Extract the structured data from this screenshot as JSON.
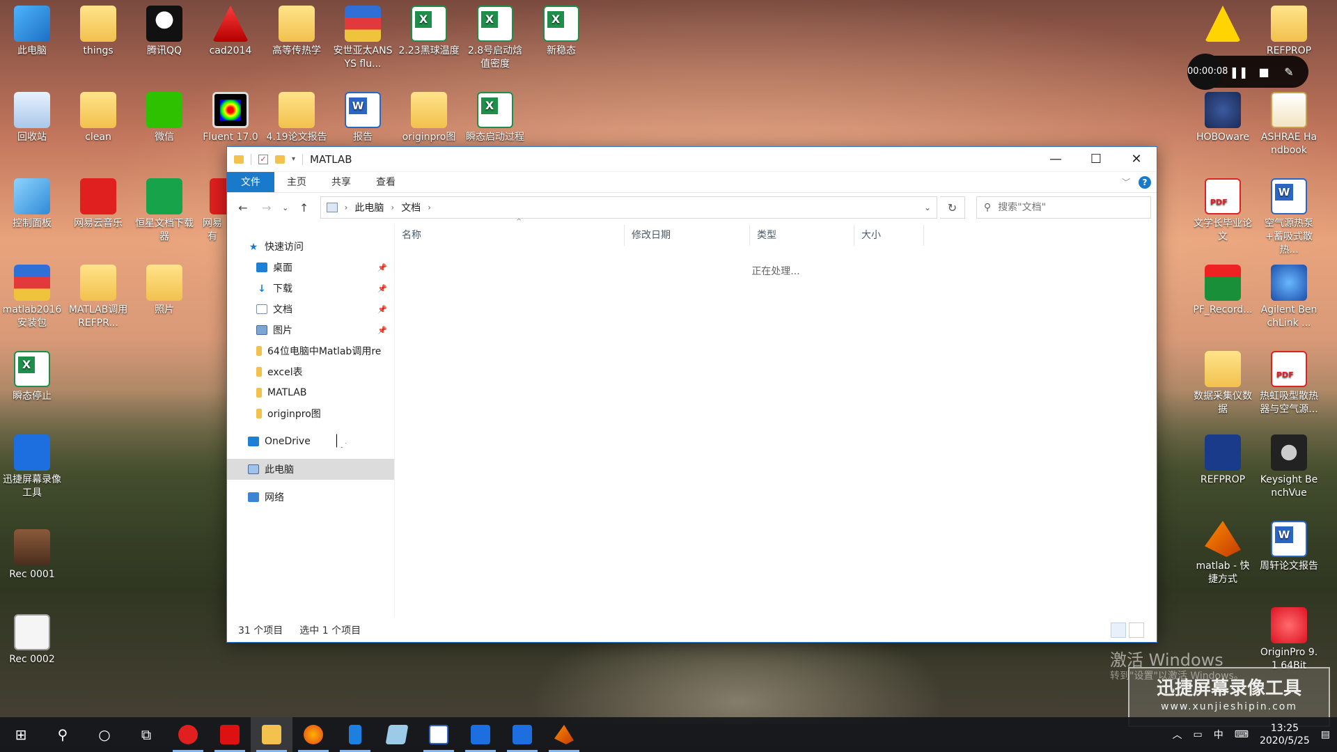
{
  "colors": {
    "accent": "#1979ca",
    "selection": "#dcdcdc",
    "taskbar": "#141619"
  },
  "desktop": {
    "icons": [
      {
        "label": "此电脑",
        "icon": "computer-icon"
      },
      {
        "label": "things",
        "icon": "folder-icon"
      },
      {
        "label": "腾讯QQ",
        "icon": "qq-icon"
      },
      {
        "label": "cad2014",
        "icon": "autocad-icon"
      },
      {
        "label": "高等传热学",
        "icon": "folder-icon"
      },
      {
        "label": "安世亚太ANSYS flu...",
        "icon": "archive-icon"
      },
      {
        "label": "2.23黑球温度",
        "icon": "excel-icon"
      },
      {
        "label": "2.8号启动焓值密度",
        "icon": "excel-icon"
      },
      {
        "label": "新稳态",
        "icon": "excel-icon"
      },
      {
        "label": "回收站",
        "icon": "recycle-bin-icon"
      },
      {
        "label": "clean",
        "icon": "folder-icon"
      },
      {
        "label": "微信",
        "icon": "wechat-icon"
      },
      {
        "label": "Fluent 17.0",
        "icon": "fluent-icon"
      },
      {
        "label": "4.19论文报告",
        "icon": "folder-icon"
      },
      {
        "label": "报告",
        "icon": "word-icon"
      },
      {
        "label": "originpro图",
        "icon": "folder-icon"
      },
      {
        "label": "瞬态启动过程",
        "icon": "excel-icon"
      },
      {
        "label": "控制面板",
        "icon": "control-panel-icon"
      },
      {
        "label": "网易云音乐",
        "icon": "netease-music-icon"
      },
      {
        "label": "恒星文档下载器",
        "icon": "downloader-icon"
      },
      {
        "label": "网易有",
        "icon": "netease-icon"
      },
      {
        "label": "matlab2016安装包",
        "icon": "archive-icon"
      },
      {
        "label": "MATLAB调用REFPR...",
        "icon": "folder-icon"
      },
      {
        "label": "照片",
        "icon": "folder-icon"
      },
      {
        "label": "瞬态停止",
        "icon": "excel-icon"
      },
      {
        "label": "迅捷屏幕录像工具",
        "icon": "screen-recorder-icon"
      },
      {
        "label": "Rec 0001",
        "icon": "video-file-icon"
      },
      {
        "label": "Rec 0002",
        "icon": "media-file-icon"
      },
      {
        "label": "REFPROP",
        "icon": "folder-icon"
      },
      {
        "label": "HOBOware",
        "icon": "hoboware-icon"
      },
      {
        "label": "ASHRAE Handbook",
        "icon": "pdf-folder-icon"
      },
      {
        "label": "文学长毕业论文",
        "icon": "pdf-icon"
      },
      {
        "label": "空气源热泵+蓄吸式散热...",
        "icon": "word-icon"
      },
      {
        "label": "PF_Record...",
        "icon": "pf-record-icon"
      },
      {
        "label": "Agilent BenchLink ...",
        "icon": "agilent-icon"
      },
      {
        "label": "数据采集仪数据",
        "icon": "folder-icon"
      },
      {
        "label": "热虹吸型散热器与空气源...",
        "icon": "pdf-icon"
      },
      {
        "label": "REFPROP",
        "icon": "refprop-icon"
      },
      {
        "label": "Keysight BenchVue",
        "icon": "keysight-icon"
      },
      {
        "label": "matlab - 快捷方式",
        "icon": "matlab-icon"
      },
      {
        "label": "周轩论文报告",
        "icon": "word-icon"
      },
      {
        "label": "OriginPro 9.1 64Bit",
        "icon": "origin-icon"
      }
    ]
  },
  "recorder": {
    "time": "00:00:08"
  },
  "explorer": {
    "title": "MATLAB",
    "tabs": [
      "文件",
      "主页",
      "共享",
      "查看"
    ],
    "breadcrumb": [
      "此电脑",
      "文档"
    ],
    "search_placeholder": "搜索\"文档\"",
    "nav": {
      "quick_access": "快速访问",
      "pinned": [
        "桌面",
        "下载",
        "文档",
        "图片"
      ],
      "folders": [
        "64位电脑中Matlab调用re",
        "excel表",
        "MATLAB",
        "originpro图"
      ],
      "onedrive": "OneDrive",
      "this_pc": "此电脑",
      "network": "网络"
    },
    "columns": [
      "名称",
      "修改日期",
      "类型",
      "大小"
    ],
    "processing": "正在处理...",
    "status": {
      "items": "31 个项目",
      "selected": "选中 1 个项目"
    }
  },
  "watermark": {
    "activate_title": "激活 Windows",
    "activate_sub": "转到\"设置\"以激活 Windows。",
    "brand": "迅捷屏幕录像工具",
    "brand_url": "www.xunjieshipin.com"
  },
  "taskbar": {
    "apps": [
      "start-icon",
      "search-icon",
      "cortana-icon",
      "task-view-icon",
      "netease-music-icon",
      "autocad-icon",
      "file-explorer-icon",
      "firefox-icon",
      "phone-icon",
      "eraser-icon",
      "word-doc-icon",
      "screen-recorder-icon",
      "screen-recorder-2-icon",
      "matlab-icon"
    ],
    "ime": "中",
    "time": "13:25",
    "date": "2020/5/25"
  }
}
